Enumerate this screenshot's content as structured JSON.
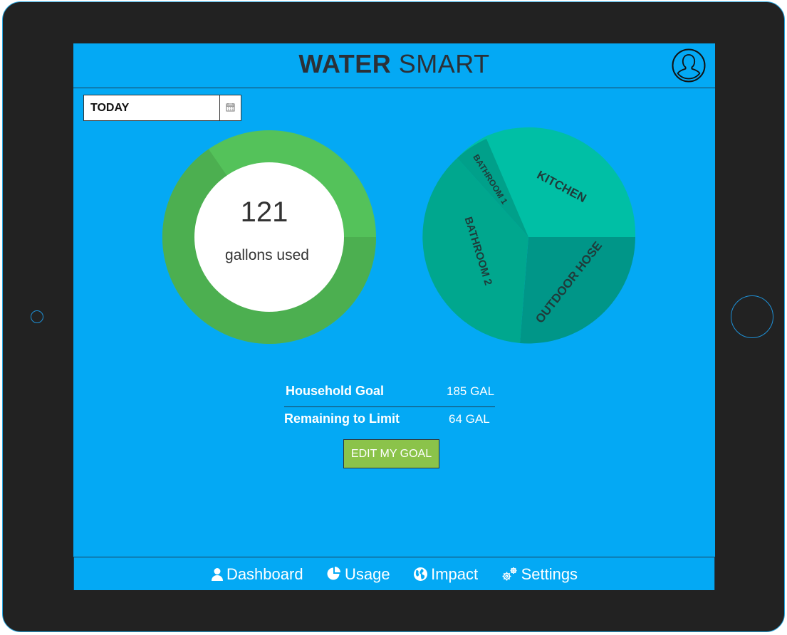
{
  "app": {
    "title_bold": "WATER",
    "title_light": "SMART"
  },
  "date_filter": {
    "selected": "TODAY",
    "icon": "calendar-icon"
  },
  "usage": {
    "value": "121",
    "unit_label": "gallons used",
    "goal_fraction_used": 0.654
  },
  "breakdown": {
    "segments": [
      {
        "label": "KITCHEN",
        "color": "#00bfa5"
      },
      {
        "label": "OUTDOOR HOSE",
        "color": "#009688"
      },
      {
        "label": "BATHROOM 2",
        "color": "#00a78e"
      },
      {
        "label": "BATHROOM 1",
        "color": "#00a08a"
      }
    ]
  },
  "stats": {
    "goal_label": "Household Goal",
    "goal_value": "185 GAL",
    "remaining_label": "Remaining to Limit",
    "remaining_value": "64 GAL"
  },
  "edit_goal_label": "EDIT MY GOAL",
  "nav": {
    "items": [
      {
        "label": "Dashboard",
        "icon": "user-icon"
      },
      {
        "label": "Usage",
        "icon": "pie-chart-icon"
      },
      {
        "label": "Impact",
        "icon": "globe-icon"
      },
      {
        "label": "Settings",
        "icon": "gears-icon"
      }
    ]
  },
  "colors": {
    "screen_bg": "#04a9f4",
    "donut_light": "#54c25a",
    "donut_dark": "#4caf50",
    "button_green": "#8bc34a"
  }
}
